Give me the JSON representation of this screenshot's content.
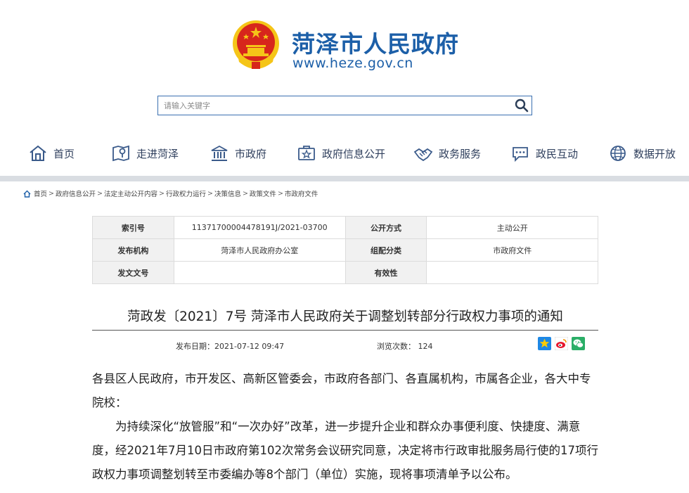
{
  "header": {
    "site_title": "菏泽市人民政府",
    "site_url": "www.heze.gov.cn",
    "emblem_icon": "national-emblem-icon"
  },
  "search": {
    "placeholder": "请输入关键字",
    "button_icon": "search-icon"
  },
  "nav": {
    "items": [
      {
        "label": "首页",
        "icon": "home-icon"
      },
      {
        "label": "走进菏泽",
        "icon": "map-pin-icon"
      },
      {
        "label": "市政府",
        "icon": "government-building-icon"
      },
      {
        "label": "政府信息公开",
        "icon": "info-card-icon"
      },
      {
        "label": "政务服务",
        "icon": "handshake-icon"
      },
      {
        "label": "政民互动",
        "icon": "chat-icon"
      },
      {
        "label": "数据开放",
        "icon": "globe-icon"
      }
    ]
  },
  "breadcrumb": [
    "首页",
    "政府信息公开",
    "法定主动公开内容",
    "行政权力运行",
    "决策信息",
    "政策文件",
    "市政府文件"
  ],
  "info": {
    "index_no_label": "索引号",
    "index_no": "11371700004478191J/2021-03700",
    "open_mode_label": "公开方式",
    "open_mode": "主动公开",
    "publisher_label": "发布机构",
    "publisher": "菏泽市人民政府办公室",
    "category_label": "组配分类",
    "category": "市政府文件",
    "doc_no_label": "发文文号",
    "doc_no": "",
    "validity_label": "有效性",
    "validity": ""
  },
  "article": {
    "title": "菏政发〔2021〕7号 菏泽市人民政府关于调整划转部分行政权力事项的通知",
    "publish_date": "发布日期：2021-07-12 09:47",
    "views": "浏览次数： 124",
    "salutation": "各县区人民政府，市开发区、高新区管委会，市政府各部门、各直属机构，市属各企业，各大中专院校：",
    "paragraph1": "为持续深化“放管服”和“一次办好”改革，进一步提升企业和群众办事便利度、快捷度、满意度，经2021年7月10日市政府第102次常务会议研究同意，决定将市行政审批服务局行使的17项行政权力事项调整划转至市委编办等8个部门（单位）实施，现将事项清单予以公布。"
  },
  "share": {
    "icons": [
      "qzone-star-icon",
      "weibo-icon",
      "wechat-icon"
    ]
  },
  "colors": {
    "brand_blue": "#1c5fa8",
    "nav_text": "#2e3e5c",
    "emblem_red": "#d7261c",
    "emblem_gold": "#f5c518"
  }
}
